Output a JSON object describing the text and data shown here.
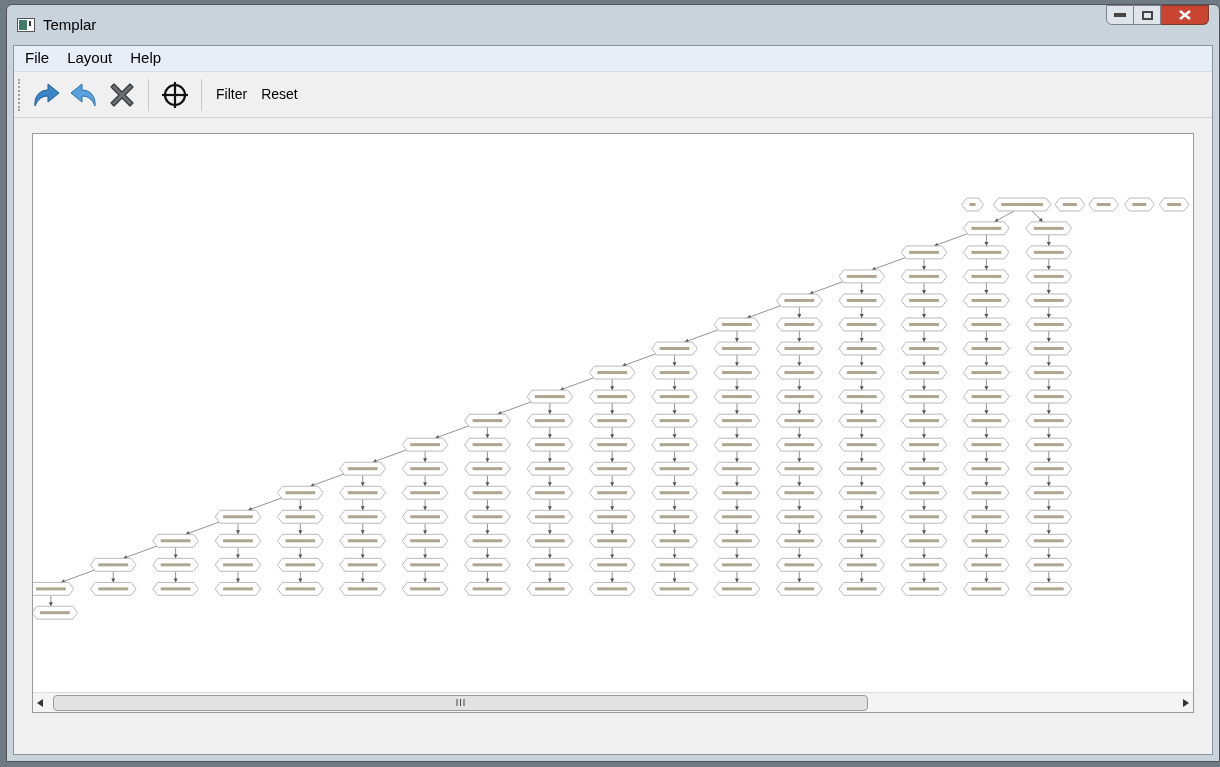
{
  "window": {
    "title": "Templar"
  },
  "menu": [
    {
      "label": "File"
    },
    {
      "label": "Layout"
    },
    {
      "label": "Help"
    }
  ],
  "toolbar": [
    {
      "kind": "redo"
    },
    {
      "kind": "undo"
    },
    {
      "kind": "delete"
    },
    {
      "kind": "separator"
    },
    {
      "kind": "center"
    },
    {
      "kind": "separator"
    },
    {
      "kind": "text",
      "label": "Filter"
    },
    {
      "kind": "text",
      "label": "Reset"
    }
  ]
}
